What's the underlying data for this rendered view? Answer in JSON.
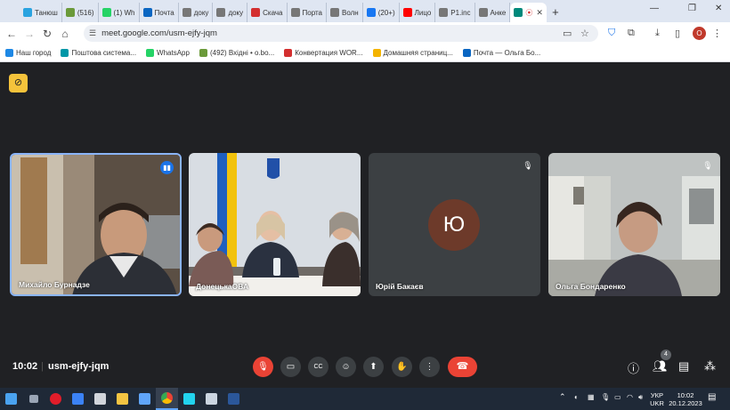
{
  "browser": {
    "tabs": [
      {
        "label": "Танюш",
        "color": "#2aa3e0"
      },
      {
        "label": "(516)",
        "color": "#6b9a3a"
      },
      {
        "label": "(1) Wh",
        "color": "#25d366"
      },
      {
        "label": "Почта",
        "color": "#0a66c2"
      },
      {
        "label": "доку",
        "color": "#777777"
      },
      {
        "label": "доку",
        "color": "#777777"
      },
      {
        "label": "Скача",
        "color": "#d32f2f"
      },
      {
        "label": "Порта",
        "color": "#777777"
      },
      {
        "label": "Волн",
        "color": "#777777"
      },
      {
        "label": "(20+)",
        "color": "#1877f2"
      },
      {
        "label": "Лицо",
        "color": "#ff0000"
      },
      {
        "label": "P1.inc",
        "color": "#777777"
      },
      {
        "label": "Анке",
        "color": "#777777"
      },
      {
        "label": "",
        "color": "#00897b"
      }
    ],
    "url": "meet.google.com/usm-ejfy-jqm",
    "profile_initial": "O",
    "bookmarks": [
      {
        "label": "Наш город",
        "color": "#1e88e5"
      },
      {
        "label": "Поштова система...",
        "color": "#0097a7"
      },
      {
        "label": "WhatsApp",
        "color": "#25d366"
      },
      {
        "label": "(492) Вхідні • o.bo...",
        "color": "#6b9a3a"
      },
      {
        "label": "Конвертация WOR...",
        "color": "#d32f2f"
      },
      {
        "label": "Домашняя страниц...",
        "color": "#f4b400"
      },
      {
        "label": "Почта — Ольга Бо...",
        "color": "#0a66c2"
      }
    ]
  },
  "meet": {
    "participants": [
      {
        "name": "Михайло Бурнадзе"
      },
      {
        "name": "ДонецькаОВА"
      },
      {
        "name": "Юрій Бакаєв",
        "initial": "Ю"
      },
      {
        "name": "Ольга Бондаренко"
      }
    ],
    "time": "10:02",
    "meeting_code": "usm-ejfy-jqm",
    "people_count": "4"
  },
  "taskbar": {
    "lang_line1": "УКР",
    "lang_line2": "UKR",
    "clock_time": "10:02",
    "clock_date": "20.12.2023"
  }
}
